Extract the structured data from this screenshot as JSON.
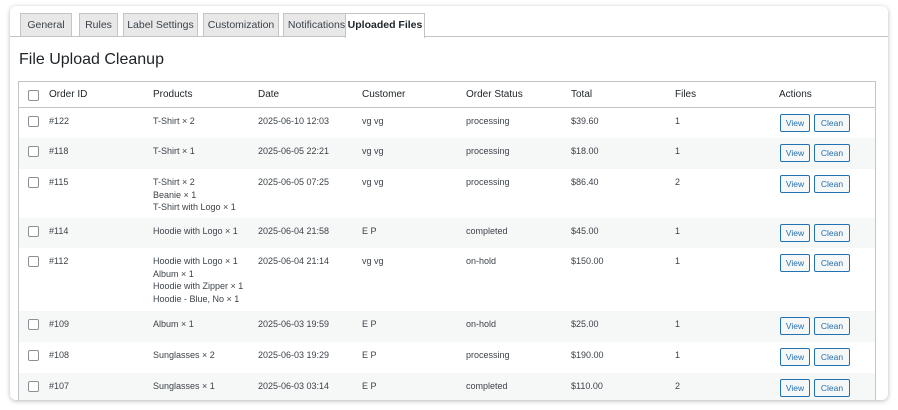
{
  "tabs": [
    {
      "label": "General"
    },
    {
      "label": "Rules"
    },
    {
      "label": "Label Settings"
    },
    {
      "label": "Customization"
    },
    {
      "label": "Notifications"
    },
    {
      "label": "Uploaded Files",
      "active": true
    }
  ],
  "page": {
    "title": "File Upload Cleanup"
  },
  "table": {
    "headers": {
      "order_id": "Order ID",
      "products": "Products",
      "date": "Date",
      "customer": "Customer",
      "order_status": "Order Status",
      "total": "Total",
      "files": "Files",
      "actions": "Actions"
    },
    "view_label": "View",
    "clean_label": "Clean",
    "rows": [
      {
        "order_id": "#122",
        "products": [
          "T-Shirt × 2"
        ],
        "date": "2025-06-10 12:03",
        "customer": "vg vg",
        "status": "processing",
        "total": "$39.60",
        "files": "1"
      },
      {
        "order_id": "#118",
        "products": [
          "T-Shirt × 1"
        ],
        "date": "2025-06-05 22:21",
        "customer": "vg vg",
        "status": "processing",
        "total": "$18.00",
        "files": "1"
      },
      {
        "order_id": "#115",
        "products": [
          "T-Shirt × 2",
          "Beanie × 1",
          "T-Shirt with Logo × 1"
        ],
        "date": "2025-06-05 07:25",
        "customer": "vg vg",
        "status": "processing",
        "total": "$86.40",
        "files": "2"
      },
      {
        "order_id": "#114",
        "products": [
          "Hoodie with Logo × 1"
        ],
        "date": "2025-06-04 21:58",
        "customer": "E P",
        "status": "completed",
        "total": "$45.00",
        "files": "1"
      },
      {
        "order_id": "#112",
        "products": [
          "Hoodie with Logo × 1",
          "Album × 1",
          "Hoodie with Zipper × 1",
          "Hoodie - Blue, No × 1"
        ],
        "date": "2025-06-04 21:14",
        "customer": "vg vg",
        "status": "on-hold",
        "total": "$150.00",
        "files": "1"
      },
      {
        "order_id": "#109",
        "products": [
          "Album × 1"
        ],
        "date": "2025-06-03 19:59",
        "customer": "E P",
        "status": "on-hold",
        "total": "$25.00",
        "files": "1"
      },
      {
        "order_id": "#108",
        "products": [
          "Sunglasses × 2"
        ],
        "date": "2025-06-03 19:29",
        "customer": "E P",
        "status": "processing",
        "total": "$190.00",
        "files": "1"
      },
      {
        "order_id": "#107",
        "products": [
          "Sunglasses × 1"
        ],
        "date": "2025-06-03 03:14",
        "customer": "E P",
        "status": "completed",
        "total": "$110.00",
        "files": "2"
      }
    ]
  },
  "colors": {
    "accent": "#2271b1",
    "stripe": "#f6f7f7",
    "border": "#c3c4c7"
  }
}
